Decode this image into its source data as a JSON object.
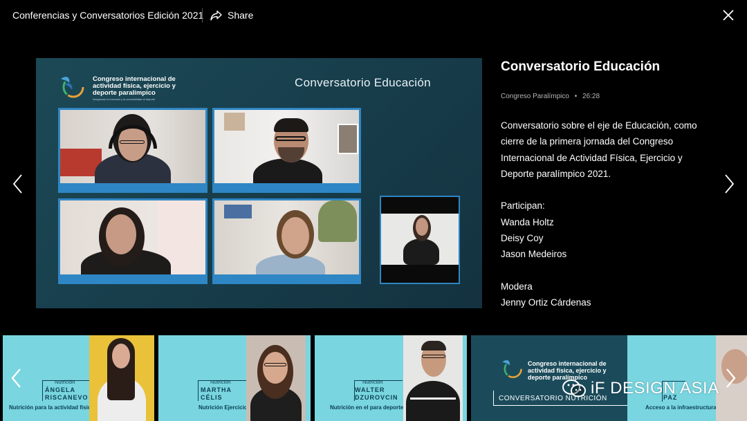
{
  "header": {
    "title": "Conferencias y Conversatorios Edición 2021",
    "share_label": "Share"
  },
  "video": {
    "logo_text": "Congreso internacional de actividad física, ejercicio y deporte paralímpico",
    "logo_subtext": "Integrando la inclusión y la accesibilidad al deporte",
    "title": "Conversatorio Educación"
  },
  "details": {
    "title": "Conversatorio Educación",
    "meta_category": "Congreso Paralímpico",
    "meta_separator": "•",
    "meta_duration": "26:28",
    "description_lines": [
      "Conversatorio sobre el eje de Educación, como",
      "cierre de la primera jornada del Congreso",
      "Internacional de Actividad Física, Ejercicio y",
      "Deporte paralímpico 2021."
    ],
    "participants_heading": "Participan:",
    "participants": [
      "Wanda Holtz",
      "Deisy Coy",
      "Jason Medeiros"
    ],
    "moderator_heading": "Modera",
    "moderator": "Jenny Ortiz Cárdenas"
  },
  "carousel": {
    "cards": [
      {
        "category": "Nutrición",
        "name_line1": "ÁNGELA",
        "name_line2": "RISCANEVO",
        "topic": "Nutrición para la actividad física"
      },
      {
        "category": "Nutrición",
        "name_line1": "MARTHA",
        "name_line2": "CÉLIS",
        "topic": "Nutrición Ejercicio"
      },
      {
        "category": "Nutrición",
        "name_line1": "WALTER",
        "name_line2": "DZUROVCIN",
        "topic": "Nutrición en el para deporte"
      },
      {
        "logo_text": "Congreso internacional de actividad física, ejercicio y deporte paralímpico",
        "label": "CONVERSATORIO NUTRICIÓN"
      },
      {
        "name_line2": "PAZ",
        "topic": "Acceso a la infraestructura"
      }
    ]
  },
  "watermark": {
    "text": "iF DESIGN ASIA"
  },
  "colors": {
    "background": "#000000",
    "tile_border": "#2f86c4",
    "video_bg": "#1c4956",
    "card_bg": "#79d5e0",
    "card_text": "#0b3f52"
  }
}
